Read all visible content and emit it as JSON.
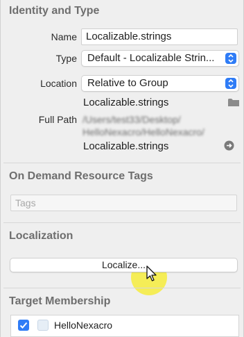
{
  "identity": {
    "title": "Identity and Type",
    "name_label": "Name",
    "name_value": "Localizable.strings",
    "type_label": "Type",
    "type_value": "Default - Localizable Strin...",
    "location_label": "Location",
    "location_value": "Relative to Group",
    "location_file": "Localizable.strings",
    "fullpath_label": "Full Path",
    "fullpath_line1": "/Users/test33/Desktop/",
    "fullpath_line2": "HelloNexacro/HelloNexacro/",
    "fullpath_file": "Localizable.strings"
  },
  "tags": {
    "title": "On Demand Resource Tags",
    "placeholder": "Tags"
  },
  "localization": {
    "title": "Localization",
    "button_label": "Localize..."
  },
  "target": {
    "title": "Target Membership",
    "items": [
      {
        "label": "HelloNexacro",
        "checked": true
      }
    ]
  },
  "icons": {
    "folder": "folder-icon",
    "reveal": "arrow-right-circle-icon",
    "popup": "updown-arrows-icon",
    "cursor": "mouse-pointer-icon"
  },
  "colors": {
    "accent": "#2f7cf6",
    "highlight": "#f6ec3c"
  }
}
